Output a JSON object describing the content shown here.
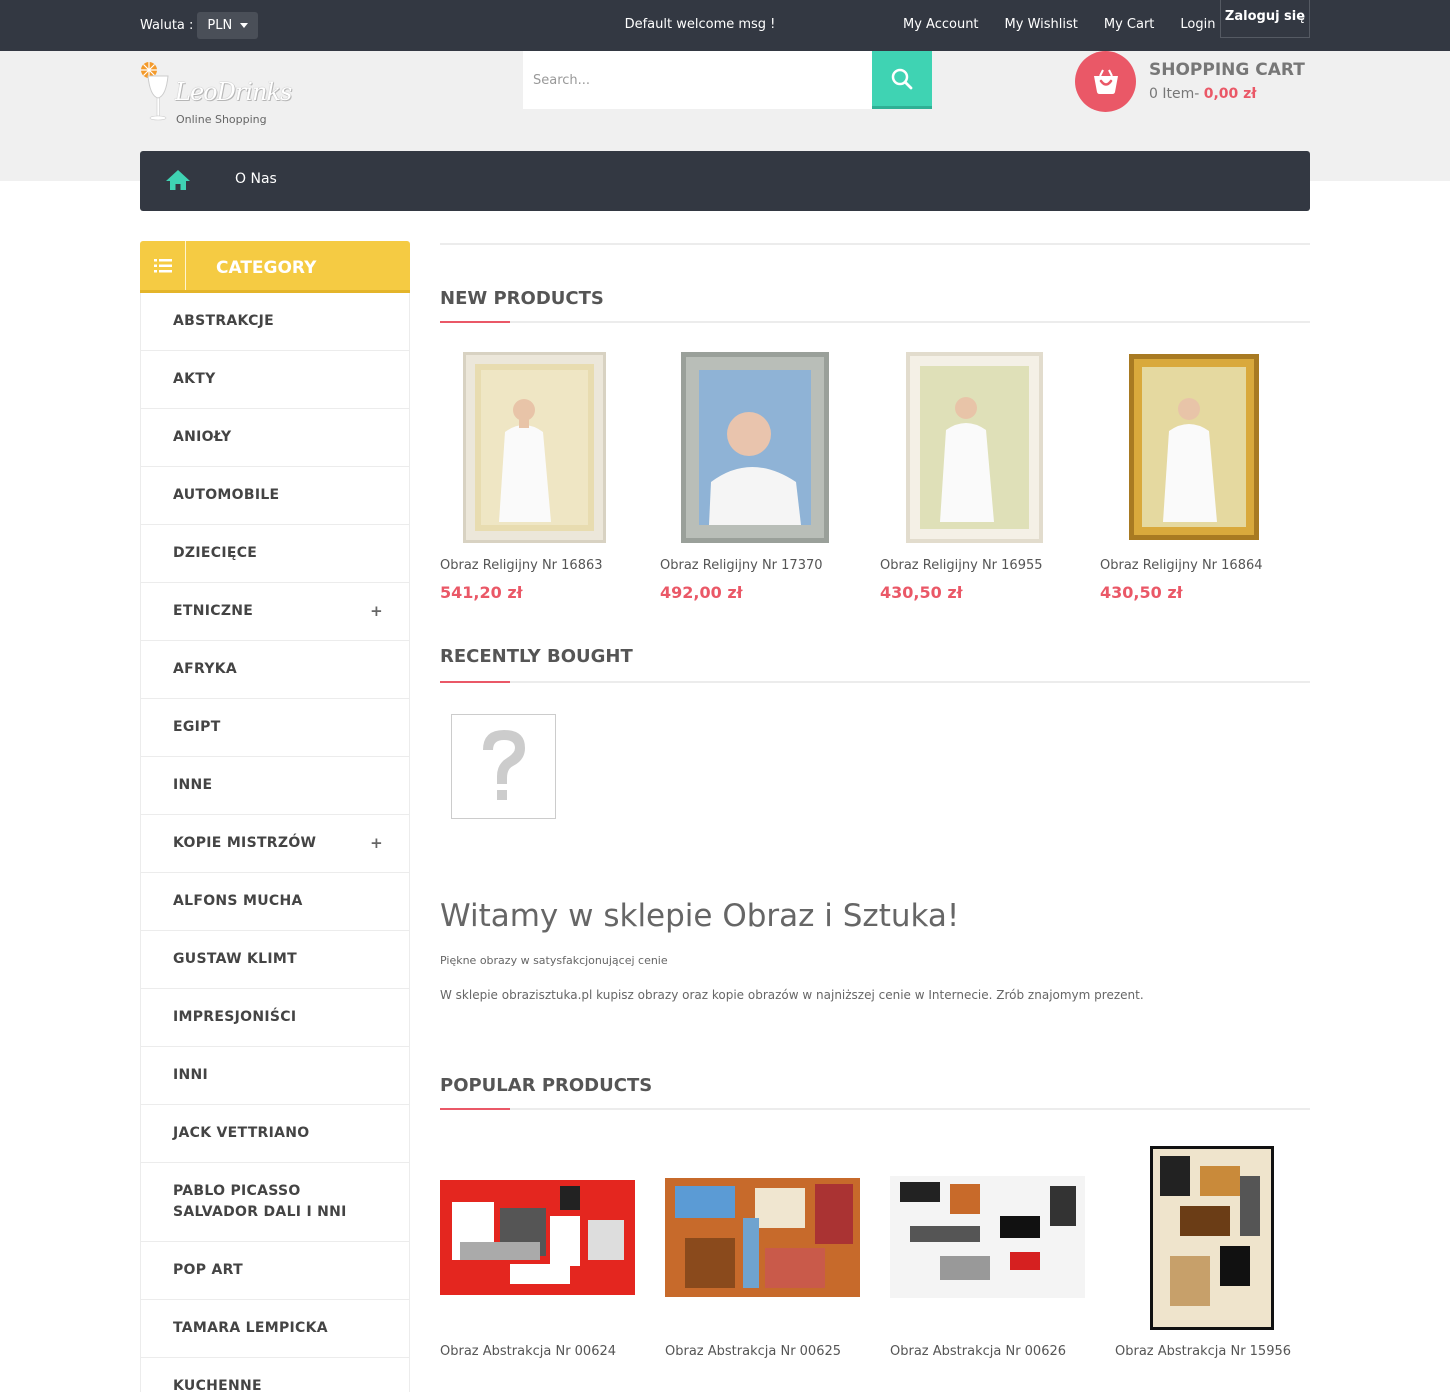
{
  "topbar": {
    "currency_label": "Waluta :",
    "currency_value": "PLN",
    "welcome": "Default welcome msg !",
    "links": [
      "My Account",
      "My Wishlist",
      "My Cart",
      "Login"
    ],
    "login_box": "Zaloguj się"
  },
  "header": {
    "logo_name": "LeoDrinks",
    "logo_sub": "Online Shopping",
    "search_placeholder": "Search...",
    "cart_title": "SHOPPING CART",
    "cart_items": "0 Item-",
    "cart_total": "0,00 zł"
  },
  "nav": {
    "items": [
      "O Nas"
    ]
  },
  "sidebar": {
    "title": "CATEGORY",
    "items": [
      {
        "label": "ABSTRAKCJE",
        "expandable": false
      },
      {
        "label": "AKTY",
        "expandable": false
      },
      {
        "label": "ANIOŁY",
        "expandable": false
      },
      {
        "label": "AUTOMOBILE",
        "expandable": false
      },
      {
        "label": "DZIECIĘCE",
        "expandable": false
      },
      {
        "label": "ETNICZNE",
        "expandable": true
      },
      {
        "label": "AFRYKA",
        "expandable": false
      },
      {
        "label": "EGIPT",
        "expandable": false
      },
      {
        "label": "INNE",
        "expandable": false
      },
      {
        "label": "KOPIE MISTRZÓW",
        "expandable": true
      },
      {
        "label": "ALFONS MUCHA",
        "expandable": false
      },
      {
        "label": "GUSTAW KLIMT",
        "expandable": false
      },
      {
        "label": "IMPRESJONIŚCI",
        "expandable": false
      },
      {
        "label": "INNI",
        "expandable": false
      },
      {
        "label": "JACK VETTRIANO",
        "expandable": false
      },
      {
        "label": "PABLO PICASSO SALVADOR DALI I NNI",
        "expandable": false
      },
      {
        "label": "POP ART",
        "expandable": false
      },
      {
        "label": "TAMARA LEMPICKA",
        "expandable": false
      },
      {
        "label": "KUCHENNE",
        "expandable": false
      }
    ]
  },
  "new_products": {
    "title": "NEW PRODUCTS",
    "items": [
      {
        "name": "Obraz Religijny Nr 16863",
        "price": "541,20 zł"
      },
      {
        "name": "Obraz Religijny Nr 17370",
        "price": "492,00 zł"
      },
      {
        "name": "Obraz Religijny Nr 16955",
        "price": "430,50 zł"
      },
      {
        "name": "Obraz Religijny Nr 16864",
        "price": "430,50 zł"
      }
    ]
  },
  "recently_bought": {
    "title": "RECENTLY BOUGHT"
  },
  "welcome_block": {
    "title": "Witamy w sklepie Obraz i Sztuka!",
    "subtitle": "Piękne obrazy w satysfakcjonującej cenie",
    "text": "W sklepie obrazisztuka.pl kupisz obrazy oraz kopie obrazów w najniższej cenie w Internecie. Zrób znajomym prezent."
  },
  "popular_products": {
    "title": "POPULAR PRODUCTS",
    "items": [
      {
        "name": "Obraz Abstrakcja Nr 00624"
      },
      {
        "name": "Obraz Abstrakcja Nr 00625"
      },
      {
        "name": "Obraz Abstrakcja Nr 00626"
      },
      {
        "name": "Obraz Abstrakcja Nr 15956"
      }
    ]
  },
  "colors": {
    "accent": "#ea5867",
    "teal": "#3fd3b3",
    "yellow": "#f5cb43",
    "dark": "#333842"
  }
}
